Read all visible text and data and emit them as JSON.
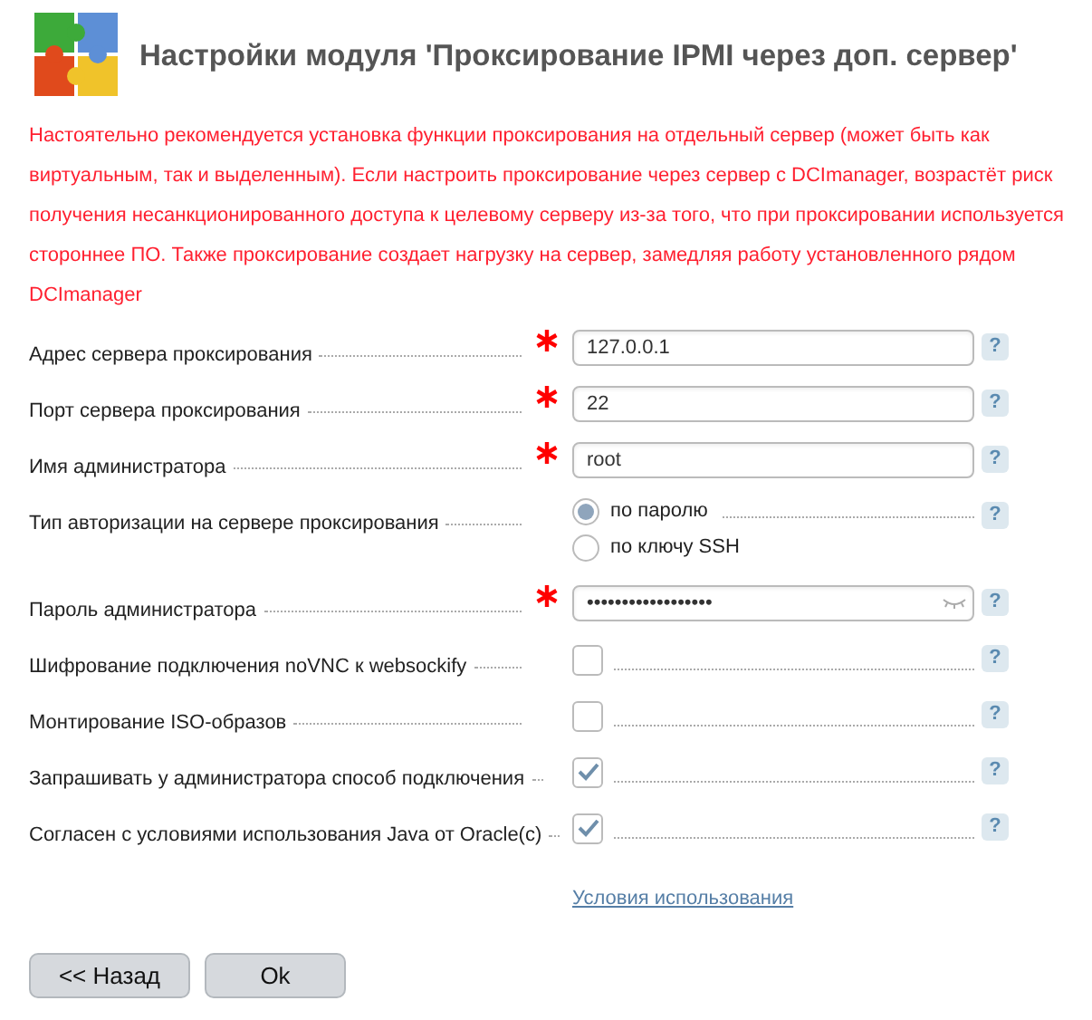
{
  "title": "Настройки модуля 'Проксирование IPMI через доп. сервер'",
  "warning": "Настоятельно рекомендуется установка функции проксирования на отдельный сервер (может быть как виртуальным, так и выделенным). Если настроить проксирование через сервер с DCImanager, возрастёт риск получения несанкционированного доступа к целевому серверу из-за того, что при проксировании используется стороннее ПО. Также проксирование создает нагрузку на сервер, замедляя работу установленного рядом DCImanager",
  "fields": [
    {
      "kind": "text",
      "label": "Адрес сервера проксирования",
      "required": true,
      "value": "127.0.0.1",
      "help": "?"
    },
    {
      "kind": "text",
      "label": "Порт сервера проксирования",
      "required": true,
      "value": "22",
      "help": "?"
    },
    {
      "kind": "text",
      "label": "Имя администратора",
      "required": true,
      "value": "root",
      "help": "?"
    },
    {
      "kind": "radio",
      "label": "Тип авторизации на сервере проксирования",
      "required": false,
      "options": [
        {
          "label": "по паролю",
          "selected": true
        },
        {
          "label": "по ключу SSH",
          "selected": false
        }
      ],
      "help": "?"
    },
    {
      "kind": "password",
      "label": "Пароль администратора",
      "required": true,
      "value": "••••••••••••••••••",
      "help": "?"
    },
    {
      "kind": "checkbox",
      "label": "Шифрование подключения noVNC к websockify",
      "required": false,
      "checked": false,
      "help": "?"
    },
    {
      "kind": "checkbox",
      "label": "Монтирование ISO-образов",
      "required": false,
      "checked": false,
      "help": "?"
    },
    {
      "kind": "checkbox",
      "label": "Запрашивать у администратора способ подключения",
      "required": false,
      "checked": true,
      "help": "?"
    },
    {
      "kind": "checkbox",
      "label": "Согласен с условиями использования Java от Oracle(c)",
      "required": false,
      "checked": true,
      "help": "?"
    }
  ],
  "link": "Условия использования",
  "buttons": [
    "<< Назад",
    "Ok"
  ]
}
